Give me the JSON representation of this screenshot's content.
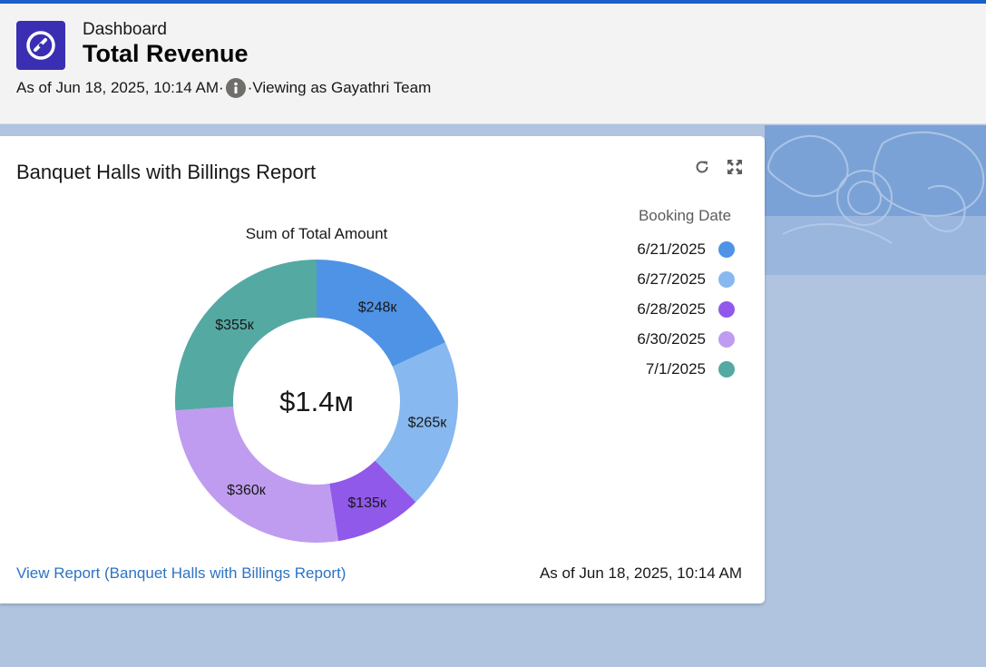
{
  "header": {
    "eyebrow": "Dashboard",
    "title": "Total Revenue",
    "as_of": "As of Jun 18, 2025, 10:14 AM·",
    "viewing": "·Viewing as Gayathri Team",
    "icon": "gauge-icon"
  },
  "card": {
    "title": "Banquet Halls with Billings Report",
    "refresh_icon": "refresh-icon",
    "expand_icon": "expand-icon",
    "view_report_link": "View Report (Banquet Halls with Billings Report)",
    "as_of": "As of Jun 18, 2025, 10:14 AM"
  },
  "colors": {
    "accent": "#1b5fc9",
    "app_icon": "#3a2fb3",
    "link": "#2e73c3"
  },
  "chart_data": {
    "type": "donut",
    "title": "Sum of Total Amount",
    "center_label": "$1.4м",
    "legend_title": "Booking Date",
    "legend_placement": "right",
    "slices": [
      {
        "label": "6/21/2025",
        "value": 248,
        "display": "$248к",
        "color": "#4f93e6"
      },
      {
        "label": "6/27/2025",
        "value": 265,
        "display": "$265к",
        "color": "#87b8ef"
      },
      {
        "label": "6/28/2025",
        "value": 135,
        "display": "$135к",
        "color": "#9159ea"
      },
      {
        "label": "6/30/2025",
        "value": 360,
        "display": "$360к",
        "color": "#bf9cf0"
      },
      {
        "label": "7/1/2025",
        "value": 355,
        "display": "$355к",
        "color": "#54a9a2"
      }
    ]
  }
}
